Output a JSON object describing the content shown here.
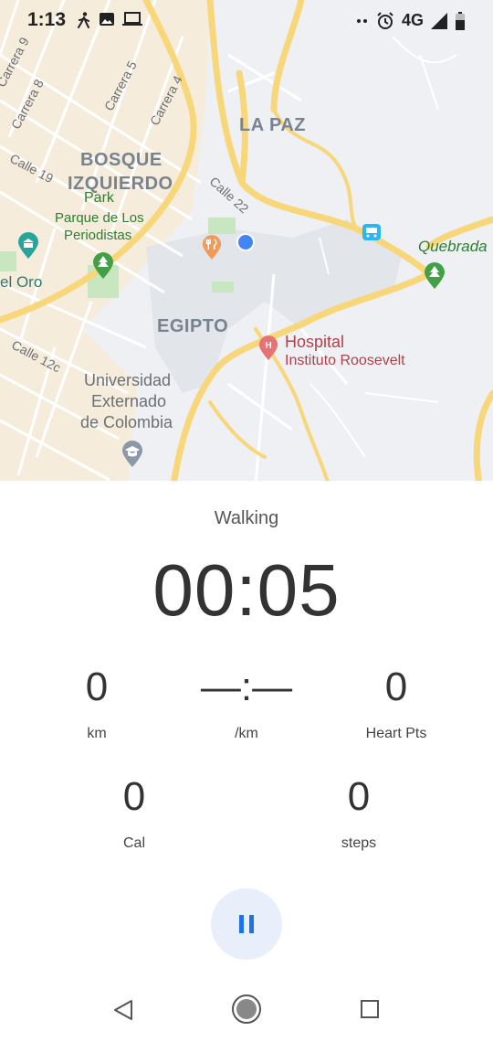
{
  "status_bar": {
    "time": "1:13",
    "left_icons": [
      "walking-icon",
      "image-icon",
      "laptop-icon"
    ],
    "network": "4G",
    "right_icons": [
      "dots-icon",
      "alarm-icon",
      "signal-icon",
      "battery-icon"
    ]
  },
  "map": {
    "neighborhoods": [
      "LA PAZ",
      "BOSQUE",
      "IZQUIERDO",
      "EGIPTO"
    ],
    "streets": [
      "Carrera 9",
      "Carrera 8",
      "Carrera 5",
      "Carrera 4",
      "Calle 19",
      "Calle 22",
      "Calle 12c"
    ],
    "places": {
      "park_word": "Park",
      "parque_line1": "Parque de Los",
      "parque_line2": "Periodistas",
      "quebrada": "Quebrada",
      "el_oro": "el Oro",
      "hospital_line1": "Hospital",
      "hospital_line2": "Instituto Roosevelt",
      "uni_line1": "Universidad",
      "uni_line2": "Externado",
      "uni_line3": "de Colombia"
    }
  },
  "workout": {
    "activity": "Walking",
    "elapsed": "00:05",
    "stats": [
      {
        "value": "0",
        "label": "km"
      },
      {
        "value": "—:—",
        "label": "/km"
      },
      {
        "value": "0",
        "label": "Heart Pts"
      },
      {
        "value": "0",
        "label": "Cal"
      },
      {
        "value": "0",
        "label": "steps"
      }
    ]
  },
  "controls": {
    "pause_icon": "pause-icon"
  },
  "nav": {
    "icons": [
      "back-icon",
      "home-icon",
      "recents-icon"
    ]
  },
  "colors": {
    "accent": "#1a73e8",
    "pause_bg": "#e8eefa",
    "road": "#f8d77a",
    "park": "#c8e6c0"
  }
}
